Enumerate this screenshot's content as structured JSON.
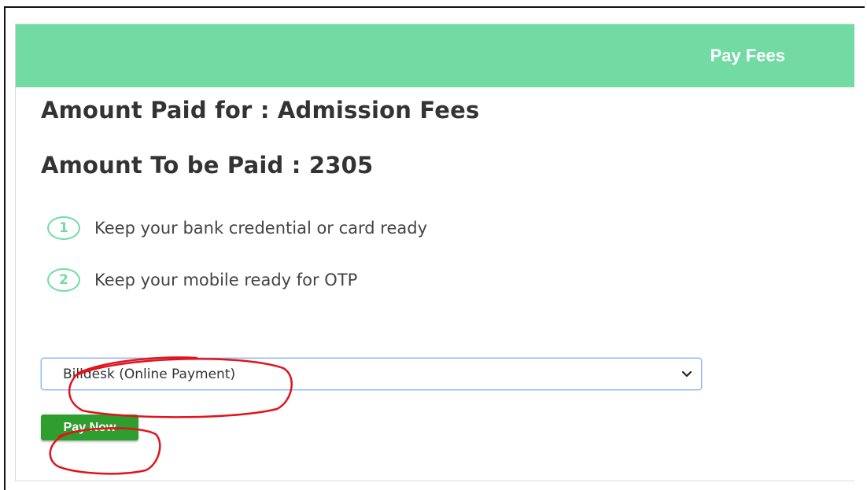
{
  "colors": {
    "accent": "#72dba4",
    "pay_button": "#2e9e2e",
    "annotation": "#e0141e"
  },
  "header": {
    "title": "Pay Fees"
  },
  "main": {
    "amount_for": "Amount Paid for : Admission Fees",
    "amount_due": "Amount To be Paid : 2305",
    "steps": [
      {
        "number": "1",
        "text": "Keep your bank credential or card ready"
      },
      {
        "number": "2",
        "text": "Keep your mobile ready for OTP"
      }
    ],
    "payment_select": {
      "selected": "Billdesk (Online Payment)",
      "icon": "chevron-down-icon"
    },
    "pay_button_label": "Pay Now"
  }
}
